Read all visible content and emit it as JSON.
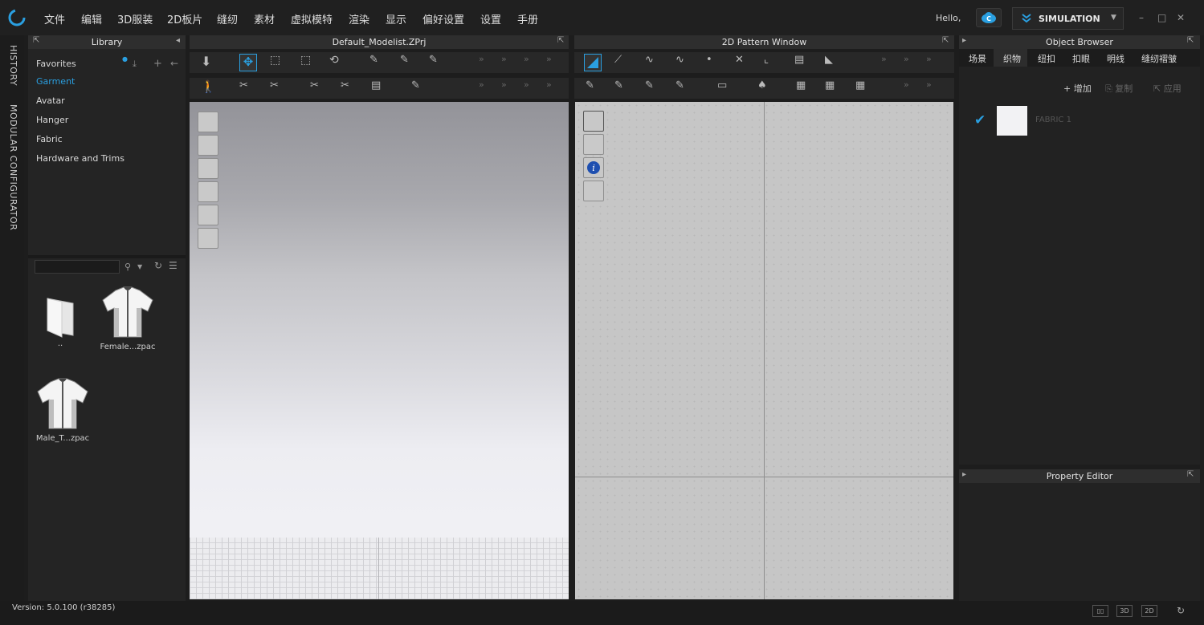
{
  "menubar": {
    "items": [
      "文件",
      "编辑",
      "3D服装",
      "2D板片",
      "缝纫",
      "素材",
      "虚拟模特",
      "渲染",
      "显示",
      "偏好设置",
      "设置",
      "手册"
    ],
    "greeting": "Hello,",
    "mode_label": "SIMULATION"
  },
  "side_tabs": {
    "history": "HISTORY",
    "configurator": "MODULAR CONFIGURATOR"
  },
  "library": {
    "title": "Library",
    "items": [
      "Favorites",
      "Garment",
      "Avatar",
      "Hanger",
      "Fabric",
      "Hardware and Trims"
    ],
    "selected": "Garment",
    "files": [
      {
        "caption": "..",
        "icon": "folder-icon"
      },
      {
        "caption": "Female...zpac",
        "icon": "shirt-icon"
      },
      {
        "caption": "Male_T...zpac",
        "icon": "shirt-icon"
      }
    ]
  },
  "view3d": {
    "title": "Default_Modelist.ZPrj"
  },
  "view2d": {
    "title": "2D Pattern Window"
  },
  "object_browser": {
    "title": "Object Browser",
    "tabs": [
      "场景",
      "织物",
      "纽扣",
      "扣眼",
      "明线",
      "缝纫褶皱"
    ],
    "active_tab": "织物",
    "actions": [
      "增加",
      "复制",
      "应用"
    ],
    "fabric_name": "FABRIC 1"
  },
  "property_editor": {
    "title": "Property Editor"
  },
  "status": {
    "version": "Version: 5.0.100 (r38285)",
    "view_3d": "3D",
    "view_2d": "2D"
  },
  "colors": {
    "accent": "#2a9fe0",
    "background": "#1d1d1d"
  }
}
